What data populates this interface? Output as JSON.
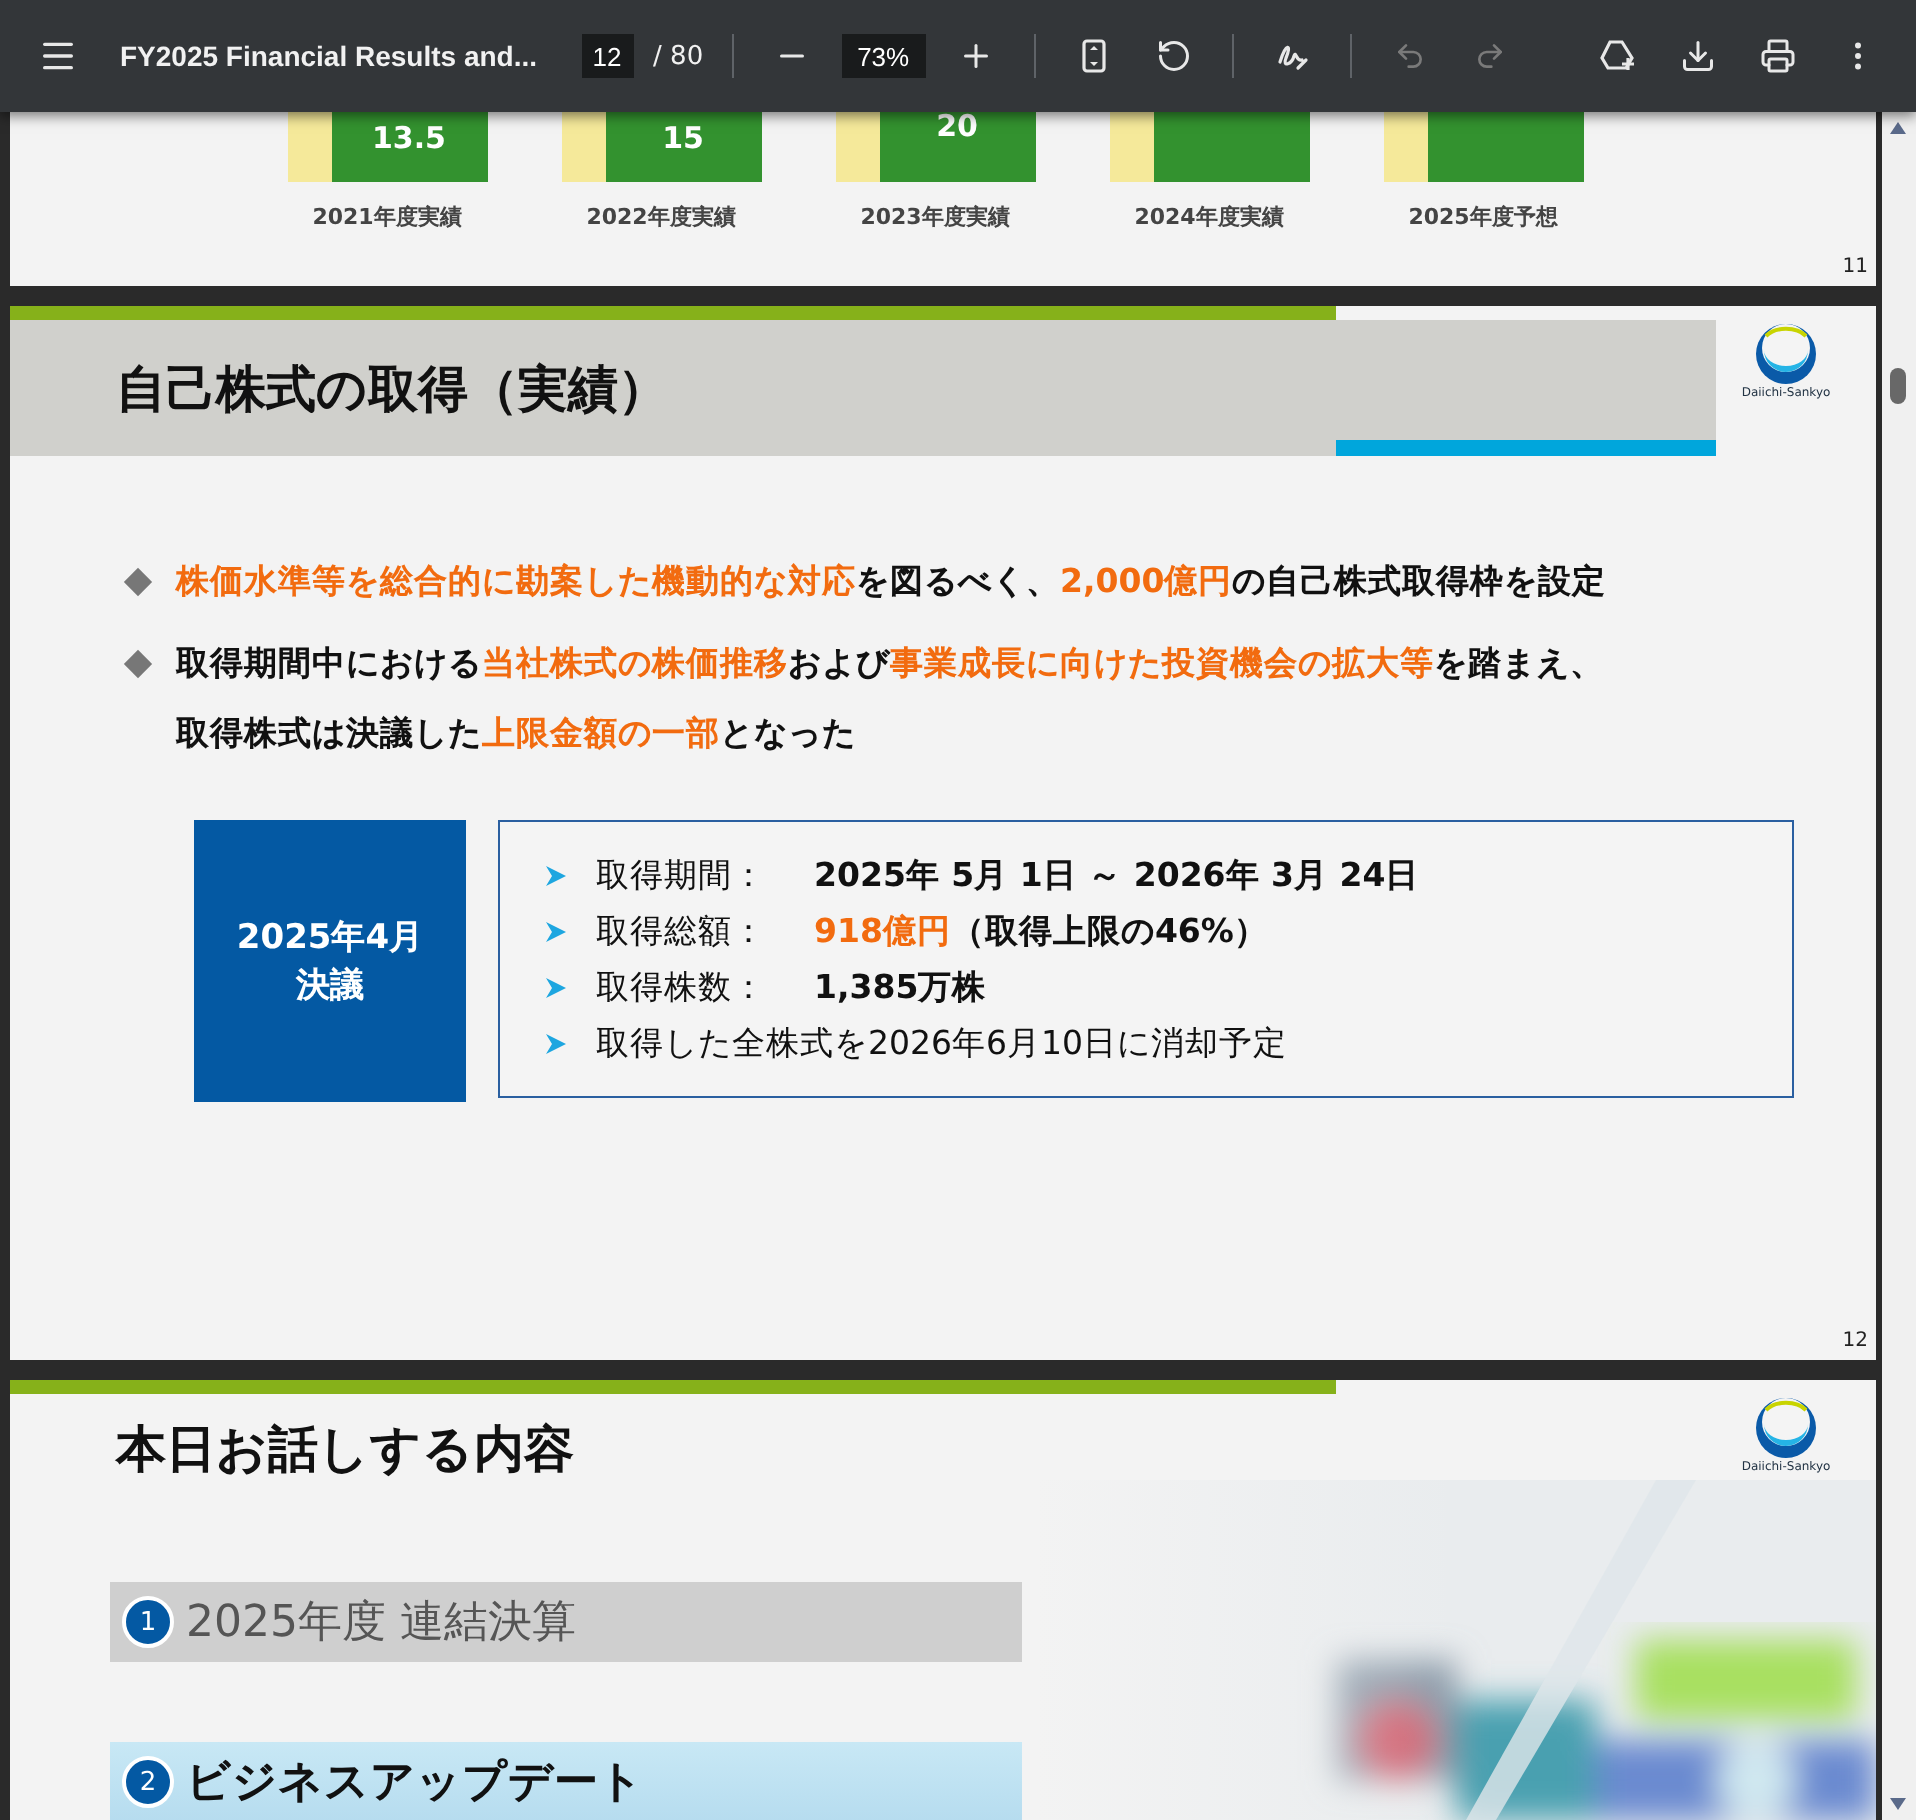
{
  "toolbar": {
    "title": "FY2025 Financial Results and...",
    "page": "12",
    "page_total": "/ 80",
    "zoom": "73%",
    "undo_disabled": true,
    "redo_disabled": true
  },
  "pages": [
    {
      "kind": "chart",
      "number": "11",
      "bars": [
        {
          "label": "13.5",
          "category": "2021年度実績"
        },
        {
          "label": "15",
          "category": "2022年度実績"
        },
        {
          "label": "20",
          "category": "2023年度実績"
        },
        {
          "category": "2024年度実績"
        },
        {
          "category": "2025年度予想"
        }
      ]
    },
    {
      "kind": "buyback",
      "number": "12",
      "title": "自己株式の取得（実績）",
      "logo": "Daiichi-Sankyo",
      "bullets": [
        {
          "lines": [
            [
              {
                "t": "株価水準等を総合的に勘案した機動的な対応",
                "hl": true
              },
              {
                "t": "を図るべく、",
                "hl": false
              },
              {
                "t": "2,000億円",
                "hl": true
              },
              {
                "t": "の自己株式取得枠を設定",
                "hl": false
              }
            ]
          ]
        },
        {
          "lines": [
            [
              {
                "t": "取得期間中における",
                "hl": false
              },
              {
                "t": "当社株式の株価推移",
                "hl": true
              },
              {
                "t": "および",
                "hl": false
              },
              {
                "t": "事業成長に向けた投資機会の拡大等",
                "hl": true
              },
              {
                "t": "を踏まえ、",
                "hl": false
              }
            ],
            [
              {
                "t": "取得株式は決議した",
                "hl": false
              },
              {
                "t": "上限金額の一部",
                "hl": true
              },
              {
                "t": "となった",
                "hl": false
              }
            ]
          ]
        }
      ],
      "decision": [
        "2025年4月",
        "決議"
      ],
      "details": [
        {
          "label": "取得期間：",
          "value": "2025年 5月 1日 ～ 2026年 3月 24日",
          "hl": false
        },
        {
          "label": "取得総額：",
          "value": "918億円",
          "hl": true,
          "note": "（取得上限の46%）"
        },
        {
          "label": "取得株数：",
          "value": "1,385万株",
          "hl": false
        },
        {
          "label": "取得した全株式を2026年6月10日に消却予定"
        }
      ]
    },
    {
      "kind": "agenda",
      "title": "本日お話しする内容",
      "logo": "Daiichi-Sankyo",
      "items": [
        {
          "num": "1",
          "label": "2025年度 連結決算",
          "selected": false
        },
        {
          "num": "2",
          "label": "ビジネスアップデート",
          "selected": true
        }
      ]
    }
  ]
}
